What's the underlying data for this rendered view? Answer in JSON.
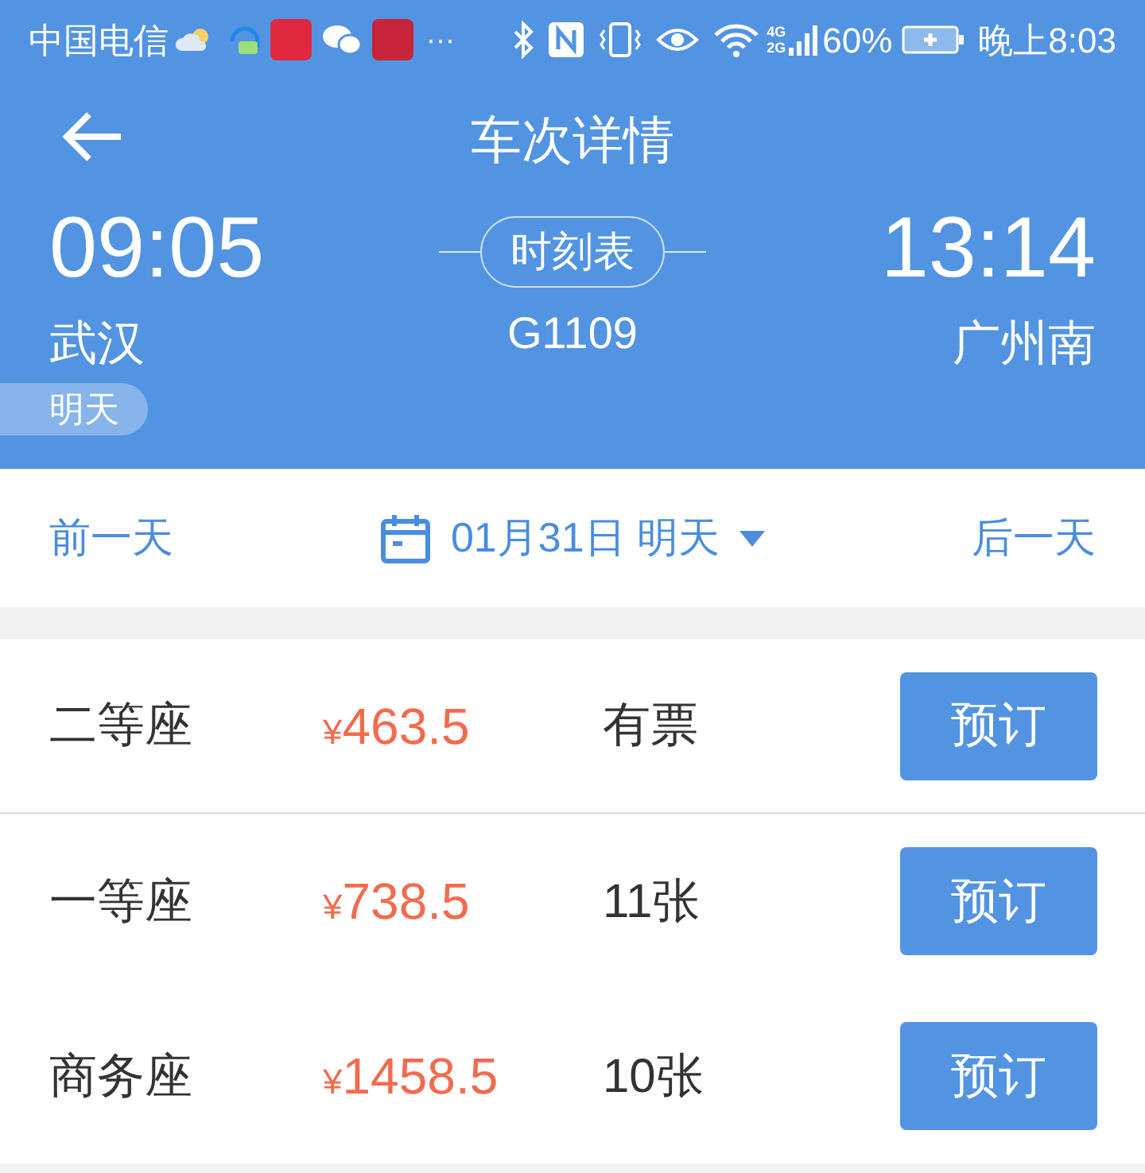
{
  "status_bar": {
    "carrier": "中国电信",
    "more": "···",
    "network": [
      "4G",
      "2G"
    ],
    "battery": "60%",
    "time": "晚上8:03"
  },
  "header": {
    "title": "车次详情"
  },
  "trip": {
    "depart_time": "09:05",
    "depart_station": "武汉",
    "depart_day": "明天",
    "timetable": "时刻表",
    "train": "G1109",
    "arrive_time": "13:14",
    "arrive_station": "广州南"
  },
  "date_bar": {
    "prev": "前一天",
    "date": "01月31日 明天",
    "next": "后一天"
  },
  "seats": [
    {
      "name": "二等座",
      "currency": "¥",
      "amount": "463.5",
      "availability": "有票",
      "action": "预订"
    },
    {
      "name": "一等座",
      "currency": "¥",
      "amount": "738.5",
      "availability": "11张",
      "action": "预订"
    },
    {
      "name": "商务座",
      "currency": "¥",
      "amount": "1458.5",
      "availability": "10张",
      "action": "预订"
    }
  ]
}
